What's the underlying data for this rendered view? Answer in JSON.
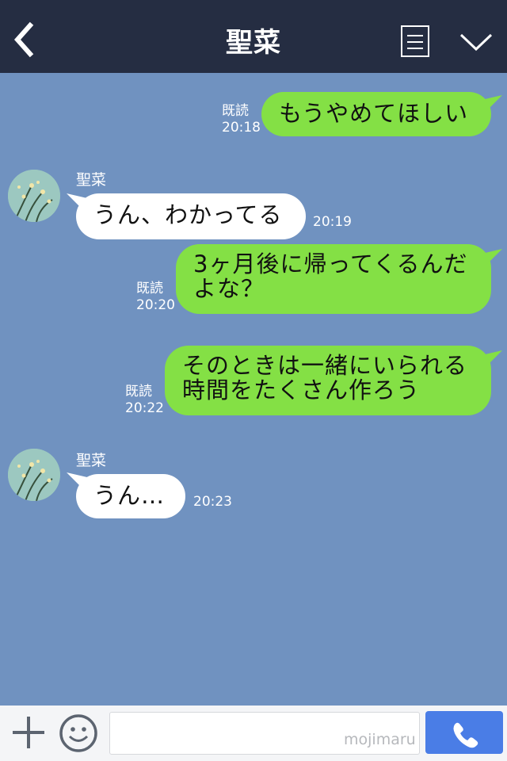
{
  "header": {
    "title": "聖菜",
    "back_icon": "chevron-left-icon",
    "menu_icon": "menu-list-icon",
    "collapse_icon": "chevron-down-icon",
    "background": "#252d42"
  },
  "chat": {
    "background": "#7092c0",
    "messages": [
      {
        "from": "me",
        "read": "既読",
        "time": "20:18",
        "lines": [
          "もうやめてほしい"
        ]
      },
      {
        "from": "them",
        "sender": "聖菜",
        "time": "20:19",
        "lines": [
          "うん、わかってる"
        ]
      },
      {
        "from": "me",
        "read": "既読",
        "time": "20:20",
        "lines": [
          "3ヶ月後に帰ってくるんだ",
          "よな？"
        ]
      },
      {
        "from": "me",
        "read": "既読",
        "time": "20:22",
        "lines": [
          "そのときは一緒にいられる",
          "時間をたくさん作ろう"
        ]
      },
      {
        "from": "them",
        "sender": "聖菜",
        "time": "20:23",
        "lines": [
          "うん…"
        ]
      }
    ],
    "colors": {
      "my_bubble": "#84e045",
      "their_bubble": "#ffffff"
    }
  },
  "inputbar": {
    "plus_icon": "plus-icon",
    "emoji_icon": "emoji-icon",
    "input_value": "",
    "watermark": "mojimaru",
    "call_icon": "phone-icon",
    "call_color": "#4a7de6"
  }
}
